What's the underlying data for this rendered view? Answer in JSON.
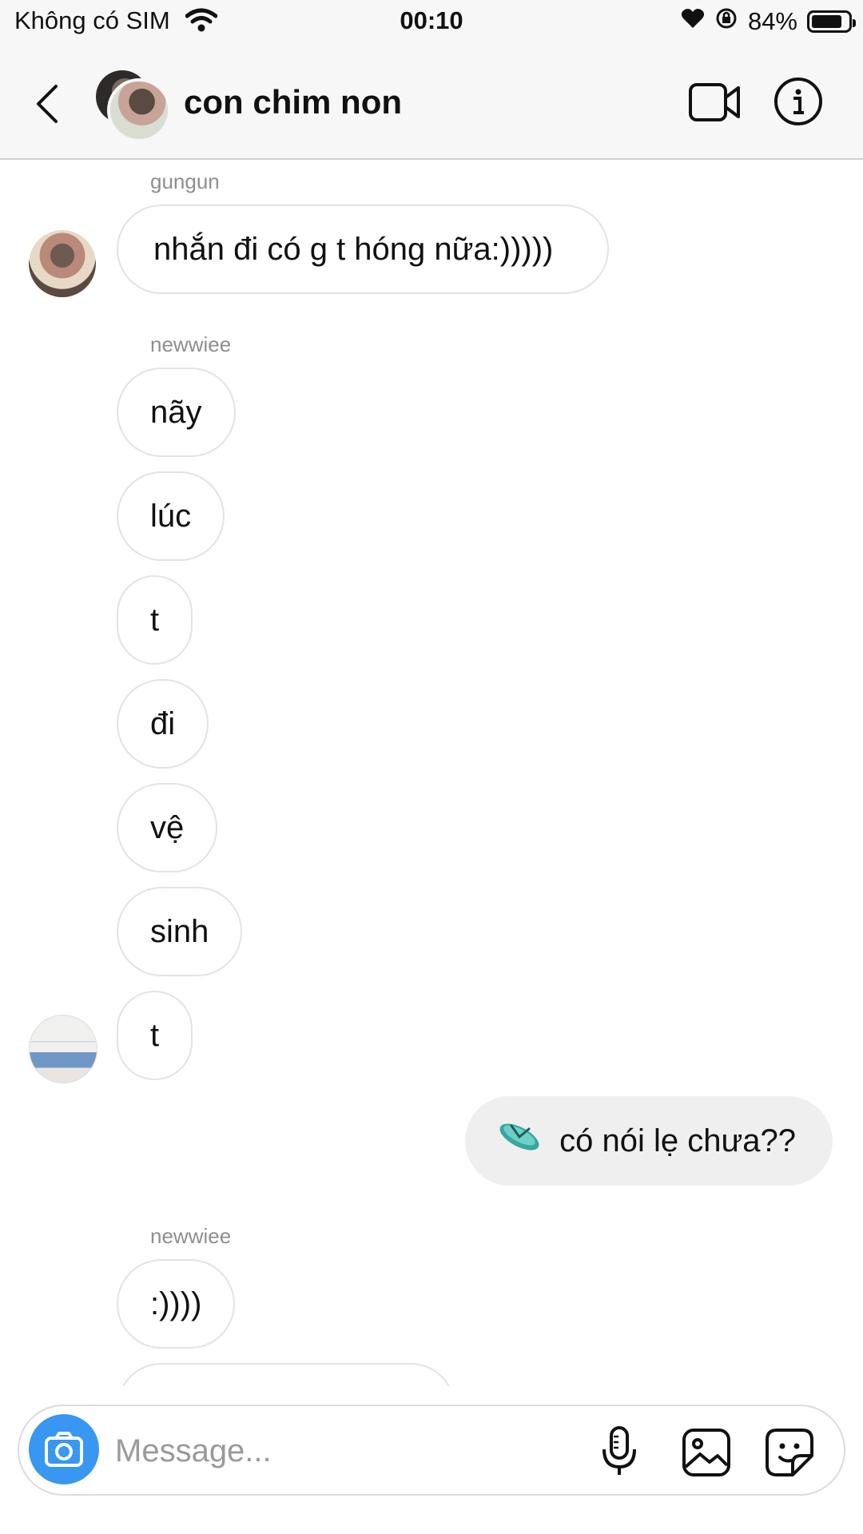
{
  "status_bar": {
    "carrier": "Không có SIM",
    "time": "00:10",
    "battery": "84%",
    "battery_level": 0.84,
    "icons": [
      "wifi-icon",
      "heart-icon",
      "rotation-lock-icon",
      "battery-icon"
    ]
  },
  "header": {
    "title": "con chim non",
    "icons": [
      "back-chevron-icon",
      "video-camera-icon",
      "info-icon"
    ]
  },
  "messages": [
    {
      "sender_label": "gungun",
      "text": "nhắn đi có g t hóng nữa:)))))",
      "direction": "incoming"
    },
    {
      "sender_label": "newwiee",
      "text": "nãy",
      "direction": "incoming"
    },
    {
      "text": "lúc",
      "direction": "incoming"
    },
    {
      "text": "t",
      "direction": "incoming"
    },
    {
      "text": "đi",
      "direction": "incoming"
    },
    {
      "text": "vệ",
      "direction": "incoming"
    },
    {
      "text": "sinh",
      "direction": "incoming"
    },
    {
      "text": "t",
      "direction": "incoming"
    },
    {
      "text": "có nói lẹ chưa??",
      "direction": "outgoing",
      "emoji": "flip-flop-icon"
    },
    {
      "sender_label": "newwiee",
      "text": ":))))",
      "direction": "incoming"
    }
  ],
  "composer": {
    "placeholder": "Message...",
    "accent": "#3897f0",
    "icons": [
      "camera-icon",
      "microphone-icon",
      "gallery-icon",
      "sticker-icon"
    ]
  }
}
